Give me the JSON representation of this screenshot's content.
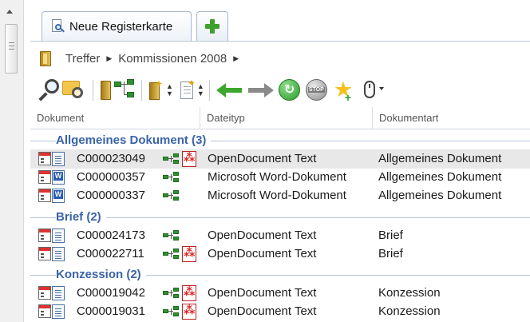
{
  "tabs": {
    "main_label": "Neue Registerkarte",
    "add_label": "+"
  },
  "breadcrumb": {
    "items": [
      "Treffer",
      "Kommissionen 2008"
    ]
  },
  "columns": [
    "Dokument",
    "Dateityp",
    "Dokumentart"
  ],
  "groups": [
    {
      "label": "Allgemeines Dokument (3)",
      "rows": [
        {
          "id": "C000023049",
          "dateityp": "OpenDocument Text",
          "dokumentart": "Allgemeines Dokument",
          "icon": "document-icon",
          "has_pdf": true,
          "selected": true
        },
        {
          "id": "C000000357",
          "dateityp": "Microsoft Word-Dokument",
          "dokumentart": "Allgemeines Dokument",
          "icon": "word-document-icon",
          "has_pdf": false,
          "selected": false
        },
        {
          "id": "C000000337",
          "dateityp": "Microsoft Word-Dokument",
          "dokumentart": "Allgemeines Dokument",
          "icon": "word-document-icon",
          "has_pdf": false,
          "selected": false
        }
      ]
    },
    {
      "label": "Brief (2)",
      "rows": [
        {
          "id": "C000024173",
          "dateityp": "OpenDocument Text",
          "dokumentart": "Brief",
          "icon": "document-icon",
          "has_pdf": false,
          "selected": false
        },
        {
          "id": "C000022711",
          "dateityp": "OpenDocument Text",
          "dokumentart": "Brief",
          "icon": "document-icon",
          "has_pdf": true,
          "selected": false
        }
      ]
    },
    {
      "label": "Konzession (2)",
      "rows": [
        {
          "id": "C000019042",
          "dateityp": "OpenDocument Text",
          "dokumentart": "Konzession",
          "icon": "document-icon",
          "has_pdf": true,
          "selected": false
        },
        {
          "id": "C000019031",
          "dateityp": "OpenDocument Text",
          "dokumentart": "Konzession",
          "icon": "document-icon",
          "has_pdf": true,
          "selected": false
        }
      ]
    }
  ],
  "toolbar_icons": [
    "search-icon",
    "folder-search-icon",
    "binder-icon",
    "tree-structure-icon",
    "new-binder-icon",
    "new-document-icon",
    "back-arrow-icon",
    "forward-arrow-icon",
    "refresh-icon",
    "stop-icon",
    "favorite-add-icon",
    "mouse-icon"
  ],
  "colors": {
    "group_label": "#3a63a8",
    "selection": "#e8e8e8",
    "tab_border": "#a9b7cc"
  }
}
